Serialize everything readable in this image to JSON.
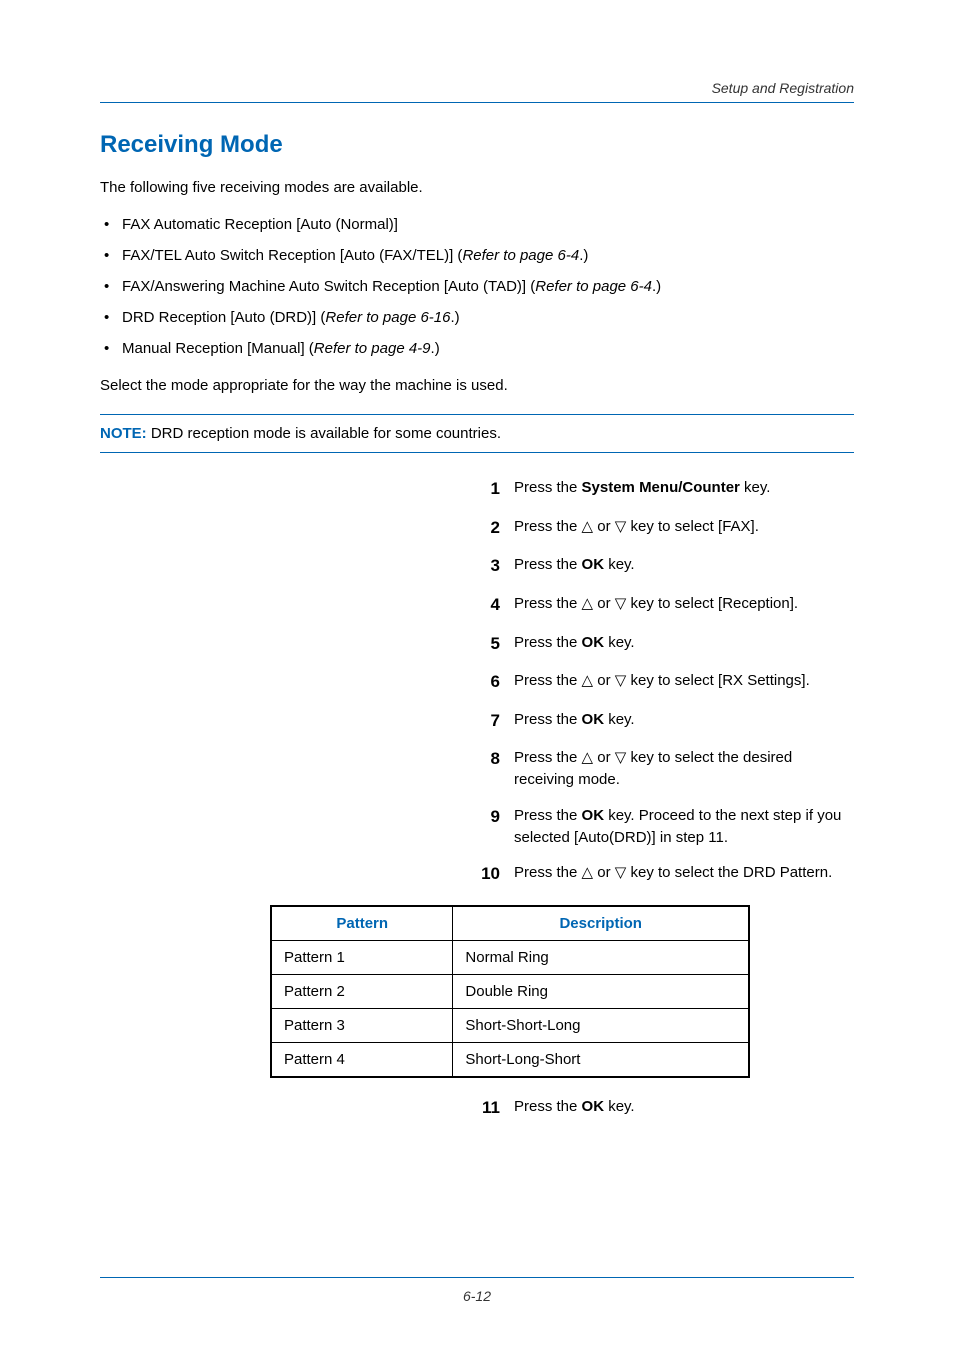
{
  "header": {
    "running_head": "Setup and Registration"
  },
  "title": "Receiving Mode",
  "intro": "The following five receiving modes are available.",
  "bullets": [
    {
      "text": "FAX Automatic Reception [Auto (Normal)]",
      "ref": ""
    },
    {
      "text": "FAX/TEL Auto Switch Reception [Auto (FAX/TEL)] (",
      "ref": "Refer to page 6-4",
      "after": ".)"
    },
    {
      "text": "FAX/Answering Machine Auto Switch Reception [Auto (TAD)] (",
      "ref": "Refer to page 6-4",
      "after": ".)"
    },
    {
      "text": "DRD Reception [Auto (DRD)] (",
      "ref": "Refer to page 6-16",
      "after": ".)"
    },
    {
      "text": "Manual Reception [Manual] (",
      "ref": "Refer to page 4-9",
      "after": ".)"
    }
  ],
  "select_line": "Select the mode appropriate for the way the machine is used.",
  "note": {
    "label": "NOTE:",
    "text": " DRD reception mode is available for some countries."
  },
  "steps_labels": {
    "press_the": "Press the ",
    "key": " key.",
    "or": " or ",
    "key_to_select": " key to select ",
    "key_proceed": " key. Proceed to the next step if you selected [Auto(DRD)] in step 11.",
    "select_drd": " key to select the DRD Pattern.",
    "select_receiving": " key to select the desired receiving mode."
  },
  "keynames": {
    "system_menu": "System Menu/Counter",
    "ok": "OK"
  },
  "tri": {
    "up": "△",
    "down": "▽"
  },
  "targets": {
    "fax": "[FAX].",
    "reception": "[Reception].",
    "rx_settings": "[RX Settings]."
  },
  "step_nums": [
    "1",
    "2",
    "3",
    "4",
    "5",
    "6",
    "7",
    "8",
    "9",
    "10",
    "11"
  ],
  "table": {
    "headers": {
      "pattern": "Pattern",
      "description": "Description"
    },
    "rows": [
      {
        "pattern": "Pattern 1",
        "desc": "Normal Ring"
      },
      {
        "pattern": "Pattern 2",
        "desc": "Double Ring"
      },
      {
        "pattern": "Pattern 3",
        "desc": "Short-Short-Long"
      },
      {
        "pattern": "Pattern 4",
        "desc": "Short-Long-Short"
      }
    ]
  },
  "footer": {
    "page": "6-12"
  }
}
